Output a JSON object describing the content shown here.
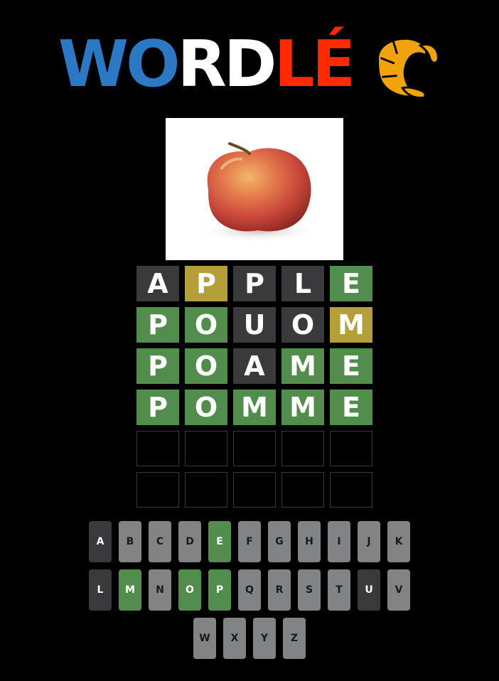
{
  "title": {
    "parts": [
      {
        "text": "WO",
        "color": "#2b78c4"
      },
      {
        "text": "RD",
        "color": "#ffffff"
      },
      {
        "text": "LÉ",
        "color": "#ff2a00"
      }
    ],
    "logo_icon": "croissant-icon"
  },
  "clue_image": {
    "subject": "apple-picture"
  },
  "colors": {
    "absent": "#3a3a3c",
    "present": "#b59f3b",
    "correct": "#538d4e",
    "unused_key": "#818384"
  },
  "board": {
    "rows": [
      [
        {
          "letter": "A",
          "state": "absent"
        },
        {
          "letter": "P",
          "state": "present"
        },
        {
          "letter": "P",
          "state": "absent"
        },
        {
          "letter": "L",
          "state": "absent"
        },
        {
          "letter": "E",
          "state": "correct"
        }
      ],
      [
        {
          "letter": "P",
          "state": "correct"
        },
        {
          "letter": "O",
          "state": "correct"
        },
        {
          "letter": "U",
          "state": "absent"
        },
        {
          "letter": "O",
          "state": "absent"
        },
        {
          "letter": "M",
          "state": "present"
        }
      ],
      [
        {
          "letter": "P",
          "state": "correct"
        },
        {
          "letter": "O",
          "state": "correct"
        },
        {
          "letter": "A",
          "state": "absent"
        },
        {
          "letter": "M",
          "state": "correct"
        },
        {
          "letter": "E",
          "state": "correct"
        }
      ],
      [
        {
          "letter": "P",
          "state": "correct"
        },
        {
          "letter": "O",
          "state": "correct"
        },
        {
          "letter": "M",
          "state": "correct"
        },
        {
          "letter": "M",
          "state": "correct"
        },
        {
          "letter": "E",
          "state": "correct"
        }
      ],
      [
        {
          "letter": "",
          "state": "empty"
        },
        {
          "letter": "",
          "state": "empty"
        },
        {
          "letter": "",
          "state": "empty"
        },
        {
          "letter": "",
          "state": "empty"
        },
        {
          "letter": "",
          "state": "empty"
        }
      ],
      [
        {
          "letter": "",
          "state": "empty"
        },
        {
          "letter": "",
          "state": "empty"
        },
        {
          "letter": "",
          "state": "empty"
        },
        {
          "letter": "",
          "state": "empty"
        },
        {
          "letter": "",
          "state": "empty"
        }
      ]
    ]
  },
  "keyboard": {
    "rows": [
      [
        {
          "key": "A",
          "state": "absent"
        },
        {
          "key": "B",
          "state": "unused"
        },
        {
          "key": "C",
          "state": "unused"
        },
        {
          "key": "D",
          "state": "unused"
        },
        {
          "key": "E",
          "state": "correct"
        },
        {
          "key": "F",
          "state": "unused"
        },
        {
          "key": "G",
          "state": "unused"
        },
        {
          "key": "H",
          "state": "unused"
        },
        {
          "key": "I",
          "state": "unused"
        },
        {
          "key": "J",
          "state": "unused"
        },
        {
          "key": "K",
          "state": "unused"
        }
      ],
      [
        {
          "key": "L",
          "state": "absent"
        },
        {
          "key": "M",
          "state": "correct"
        },
        {
          "key": "N",
          "state": "unused"
        },
        {
          "key": "O",
          "state": "correct"
        },
        {
          "key": "P",
          "state": "correct"
        },
        {
          "key": "Q",
          "state": "unused"
        },
        {
          "key": "R",
          "state": "unused"
        },
        {
          "key": "S",
          "state": "unused"
        },
        {
          "key": "T",
          "state": "unused"
        },
        {
          "key": "U",
          "state": "absent"
        },
        {
          "key": "V",
          "state": "unused"
        }
      ],
      [
        {
          "key": "W",
          "state": "unused"
        },
        {
          "key": "X",
          "state": "unused"
        },
        {
          "key": "Y",
          "state": "unused"
        },
        {
          "key": "Z",
          "state": "unused"
        }
      ]
    ]
  }
}
